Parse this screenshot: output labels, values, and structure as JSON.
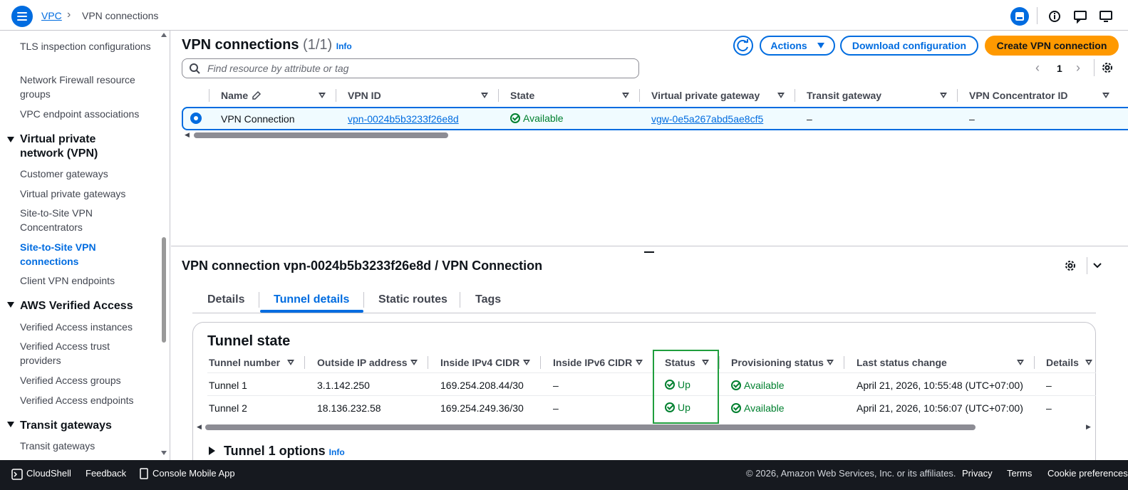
{
  "breadcrumb": {
    "root": "VPC",
    "current": "VPN connections"
  },
  "sidebar": {
    "items_top": [
      {
        "label": "TLS inspection configurations"
      },
      {
        "label": "Network Firewall resource groups"
      },
      {
        "label": "VPC endpoint associations"
      }
    ],
    "sections": [
      {
        "title": "Virtual private network (VPN)",
        "items": [
          "Customer gateways",
          "Virtual private gateways",
          "Site-to-Site VPN Concentrators",
          "Site-to-Site VPN connections",
          "Client VPN endpoints"
        ],
        "active": "Site-to-Site VPN connections"
      },
      {
        "title": "AWS Verified Access",
        "items": [
          "Verified Access instances",
          "Verified Access trust providers",
          "Verified Access groups",
          "Verified Access endpoints"
        ]
      },
      {
        "title": "Transit gateways",
        "items": [
          "Transit gateways"
        ]
      }
    ]
  },
  "main": {
    "title": "VPN connections",
    "count": "(1/1)",
    "info": "Info",
    "actions_label": "Actions",
    "download_label": "Download configuration",
    "create_label": "Create VPN connection",
    "search_placeholder": "Find resource by attribute or tag",
    "page_number": "1",
    "columns": [
      "Name",
      "VPN ID",
      "State",
      "Virtual private gateway",
      "Transit gateway",
      "VPN Concentrator ID"
    ],
    "row": {
      "name": "VPN Connection",
      "vpn_id": "vpn-0024b5b3233f26e8d",
      "state": "Available",
      "vgw": "vgw-0e5a267abd5ae8cf5",
      "tgw": "–",
      "concentrator": "–"
    }
  },
  "details": {
    "title": "VPN connection vpn-0024b5b3233f26e8d / VPN Connection",
    "tabs": [
      "Details",
      "Tunnel details",
      "Static routes",
      "Tags"
    ],
    "active_tab": "Tunnel details",
    "tunnel_state_title": "Tunnel state",
    "columns": [
      "Tunnel number",
      "Outside IP address",
      "Inside IPv4 CIDR",
      "Inside IPv6 CIDR",
      "Status",
      "Provisioning status",
      "Last status change",
      "Details"
    ],
    "rows": [
      {
        "tunnel": "Tunnel 1",
        "outside_ip": "3.1.142.250",
        "ipv4": "169.254.208.44/30",
        "ipv6": "–",
        "status": "Up",
        "prov": "Available",
        "last_change": "April 21, 2026, 10:55:48 (UTC+07:00)",
        "details": "–"
      },
      {
        "tunnel": "Tunnel 2",
        "outside_ip": "18.136.232.58",
        "ipv4": "169.254.249.36/30",
        "ipv6": "–",
        "status": "Up",
        "prov": "Available",
        "last_change": "April 21, 2026, 10:56:07 (UTC+07:00)",
        "details": "–"
      }
    ],
    "tunnel1_options": "Tunnel 1 options",
    "info": "Info"
  },
  "footer": {
    "cloudshell": "CloudShell",
    "feedback": "Feedback",
    "mobile": "Console Mobile App",
    "copyright": "© 2026, Amazon Web Services, Inc. or its affiliates.",
    "privacy": "Privacy",
    "terms": "Terms",
    "cookies": "Cookie preferences"
  },
  "colors": {
    "accent": "#006ce0",
    "primary_button": "#ff9900",
    "success": "#00802f",
    "highlight_box": "#1f9e3d",
    "footer_bg": "#16191f"
  }
}
